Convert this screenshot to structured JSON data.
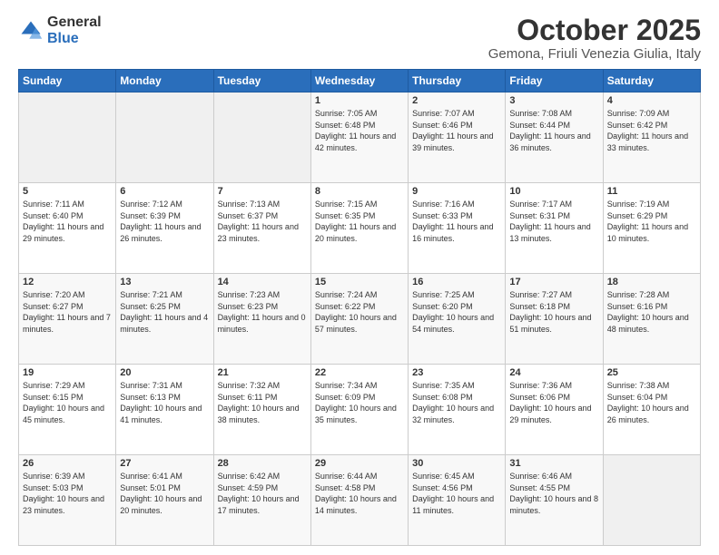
{
  "logo": {
    "general": "General",
    "blue": "Blue"
  },
  "header": {
    "month": "October 2025",
    "location": "Gemona, Friuli Venezia Giulia, Italy"
  },
  "weekdays": [
    "Sunday",
    "Monday",
    "Tuesday",
    "Wednesday",
    "Thursday",
    "Friday",
    "Saturday"
  ],
  "weeks": [
    [
      {
        "day": "",
        "info": ""
      },
      {
        "day": "",
        "info": ""
      },
      {
        "day": "",
        "info": ""
      },
      {
        "day": "1",
        "info": "Sunrise: 7:05 AM\nSunset: 6:48 PM\nDaylight: 11 hours and 42 minutes."
      },
      {
        "day": "2",
        "info": "Sunrise: 7:07 AM\nSunset: 6:46 PM\nDaylight: 11 hours and 39 minutes."
      },
      {
        "day": "3",
        "info": "Sunrise: 7:08 AM\nSunset: 6:44 PM\nDaylight: 11 hours and 36 minutes."
      },
      {
        "day": "4",
        "info": "Sunrise: 7:09 AM\nSunset: 6:42 PM\nDaylight: 11 hours and 33 minutes."
      }
    ],
    [
      {
        "day": "5",
        "info": "Sunrise: 7:11 AM\nSunset: 6:40 PM\nDaylight: 11 hours and 29 minutes."
      },
      {
        "day": "6",
        "info": "Sunrise: 7:12 AM\nSunset: 6:39 PM\nDaylight: 11 hours and 26 minutes."
      },
      {
        "day": "7",
        "info": "Sunrise: 7:13 AM\nSunset: 6:37 PM\nDaylight: 11 hours and 23 minutes."
      },
      {
        "day": "8",
        "info": "Sunrise: 7:15 AM\nSunset: 6:35 PM\nDaylight: 11 hours and 20 minutes."
      },
      {
        "day": "9",
        "info": "Sunrise: 7:16 AM\nSunset: 6:33 PM\nDaylight: 11 hours and 16 minutes."
      },
      {
        "day": "10",
        "info": "Sunrise: 7:17 AM\nSunset: 6:31 PM\nDaylight: 11 hours and 13 minutes."
      },
      {
        "day": "11",
        "info": "Sunrise: 7:19 AM\nSunset: 6:29 PM\nDaylight: 11 hours and 10 minutes."
      }
    ],
    [
      {
        "day": "12",
        "info": "Sunrise: 7:20 AM\nSunset: 6:27 PM\nDaylight: 11 hours and 7 minutes."
      },
      {
        "day": "13",
        "info": "Sunrise: 7:21 AM\nSunset: 6:25 PM\nDaylight: 11 hours and 4 minutes."
      },
      {
        "day": "14",
        "info": "Sunrise: 7:23 AM\nSunset: 6:23 PM\nDaylight: 11 hours and 0 minutes."
      },
      {
        "day": "15",
        "info": "Sunrise: 7:24 AM\nSunset: 6:22 PM\nDaylight: 10 hours and 57 minutes."
      },
      {
        "day": "16",
        "info": "Sunrise: 7:25 AM\nSunset: 6:20 PM\nDaylight: 10 hours and 54 minutes."
      },
      {
        "day": "17",
        "info": "Sunrise: 7:27 AM\nSunset: 6:18 PM\nDaylight: 10 hours and 51 minutes."
      },
      {
        "day": "18",
        "info": "Sunrise: 7:28 AM\nSunset: 6:16 PM\nDaylight: 10 hours and 48 minutes."
      }
    ],
    [
      {
        "day": "19",
        "info": "Sunrise: 7:29 AM\nSunset: 6:15 PM\nDaylight: 10 hours and 45 minutes."
      },
      {
        "day": "20",
        "info": "Sunrise: 7:31 AM\nSunset: 6:13 PM\nDaylight: 10 hours and 41 minutes."
      },
      {
        "day": "21",
        "info": "Sunrise: 7:32 AM\nSunset: 6:11 PM\nDaylight: 10 hours and 38 minutes."
      },
      {
        "day": "22",
        "info": "Sunrise: 7:34 AM\nSunset: 6:09 PM\nDaylight: 10 hours and 35 minutes."
      },
      {
        "day": "23",
        "info": "Sunrise: 7:35 AM\nSunset: 6:08 PM\nDaylight: 10 hours and 32 minutes."
      },
      {
        "day": "24",
        "info": "Sunrise: 7:36 AM\nSunset: 6:06 PM\nDaylight: 10 hours and 29 minutes."
      },
      {
        "day": "25",
        "info": "Sunrise: 7:38 AM\nSunset: 6:04 PM\nDaylight: 10 hours and 26 minutes."
      }
    ],
    [
      {
        "day": "26",
        "info": "Sunrise: 6:39 AM\nSunset: 5:03 PM\nDaylight: 10 hours and 23 minutes."
      },
      {
        "day": "27",
        "info": "Sunrise: 6:41 AM\nSunset: 5:01 PM\nDaylight: 10 hours and 20 minutes."
      },
      {
        "day": "28",
        "info": "Sunrise: 6:42 AM\nSunset: 4:59 PM\nDaylight: 10 hours and 17 minutes."
      },
      {
        "day": "29",
        "info": "Sunrise: 6:44 AM\nSunset: 4:58 PM\nDaylight: 10 hours and 14 minutes."
      },
      {
        "day": "30",
        "info": "Sunrise: 6:45 AM\nSunset: 4:56 PM\nDaylight: 10 hours and 11 minutes."
      },
      {
        "day": "31",
        "info": "Sunrise: 6:46 AM\nSunset: 4:55 PM\nDaylight: 10 hours and 8 minutes."
      },
      {
        "day": "",
        "info": ""
      }
    ]
  ]
}
